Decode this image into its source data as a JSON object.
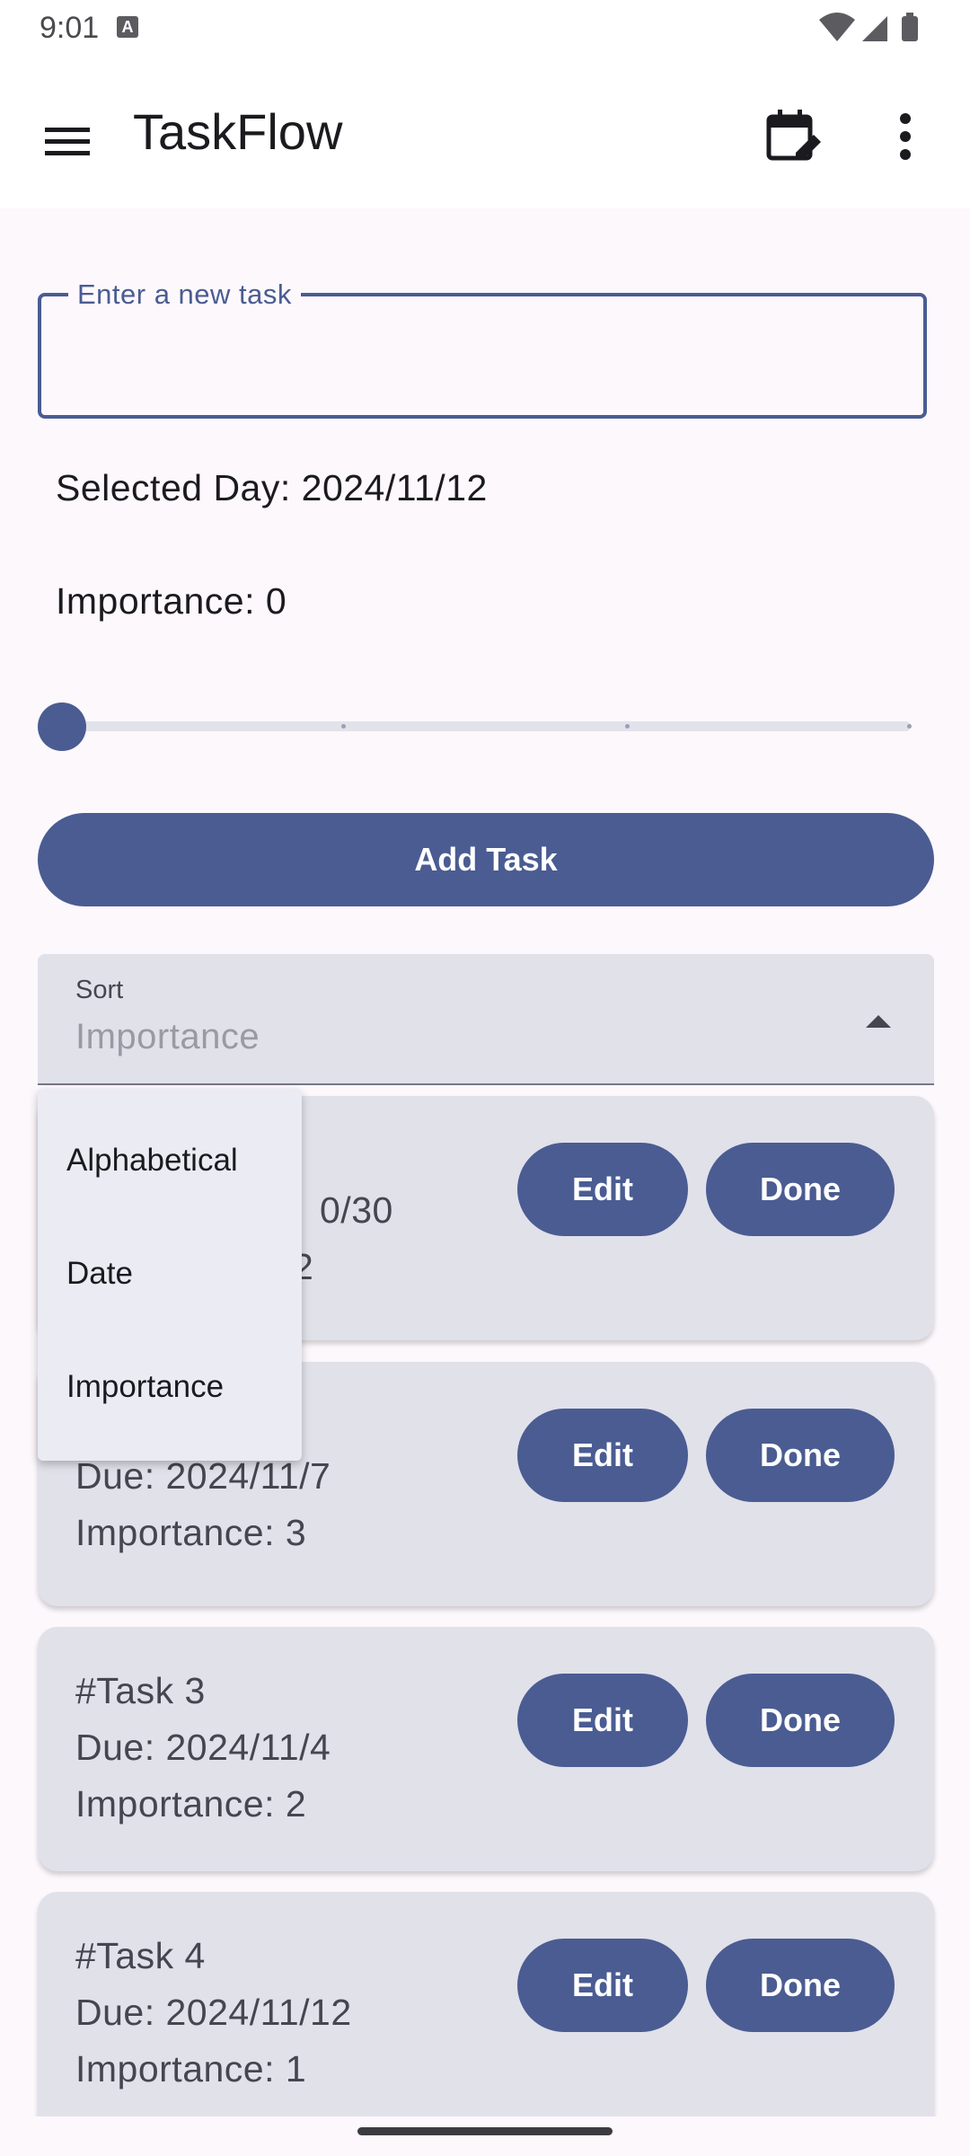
{
  "status_bar": {
    "time": "9:01",
    "notification_letter": "A"
  },
  "app_bar": {
    "title": "TaskFlow"
  },
  "new_task": {
    "label": "Enter a new task",
    "value": ""
  },
  "selected_day": "Selected Day: 2024/11/12",
  "importance_label": "Importance: 0",
  "importance_slider": {
    "value": 0,
    "min": 0,
    "max": 3
  },
  "add_button_label": "Add Task",
  "sort": {
    "label": "Sort",
    "value": "Importance"
  },
  "sort_menu": {
    "items": [
      "Alphabetical",
      "Date",
      "Importance"
    ]
  },
  "tasks": [
    {
      "title": "",
      "due": "0/30",
      "importance": "2"
    },
    {
      "title": "",
      "due": "Due: 2024/11/7",
      "importance": "Importance: 3"
    },
    {
      "title": "#Task 3",
      "due": "Due: 2024/11/4",
      "importance": "Importance: 2"
    },
    {
      "title": "#Task 4",
      "due": "Due: 2024/11/12",
      "importance": "Importance: 1"
    }
  ],
  "buttons": {
    "edit": "Edit",
    "done": "Done"
  },
  "colors": {
    "primary": "#4a5c92",
    "surface": "#fdf8fc",
    "card": "#e1e1ea",
    "menu": "#ebebf4"
  }
}
